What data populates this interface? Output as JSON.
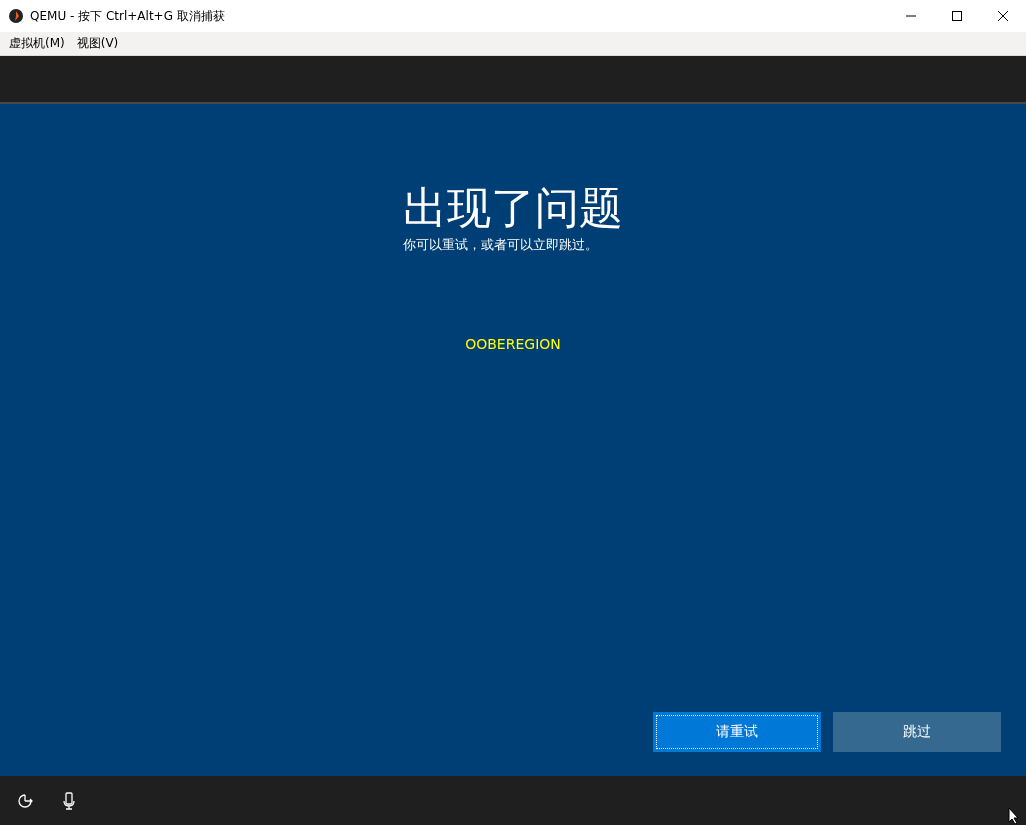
{
  "window": {
    "title": "QEMU - 按下 Ctrl+Alt+G 取消捕获"
  },
  "menu": [
    "虚拟机(M)",
    "视图(V)"
  ],
  "screen": {
    "title": "出现了问题",
    "subtitle": "你可以重试，或者可以立即跳过。",
    "code": "OOBEREGION",
    "buttons": [
      {
        "label": "请重试",
        "kind": "primary",
        "focused": true
      },
      {
        "label": "跳过",
        "kind": "secondary",
        "focused": false
      }
    ]
  }
}
